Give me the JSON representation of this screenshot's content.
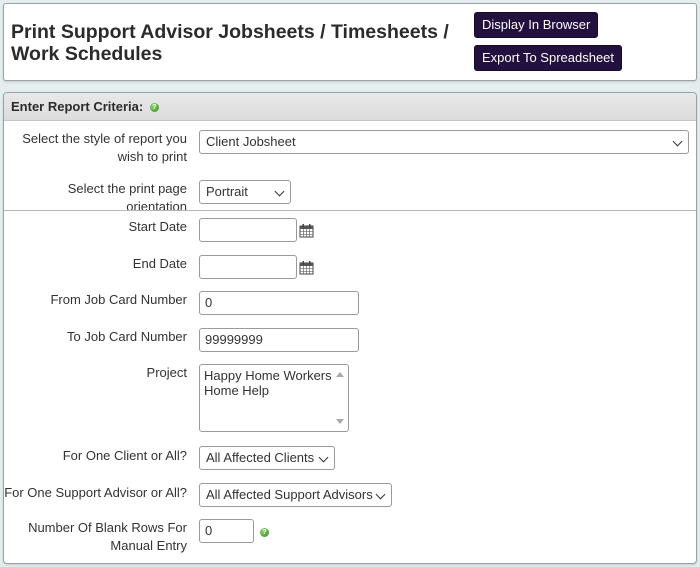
{
  "header": {
    "title": "Print Support Advisor Jobsheets / Timesheets / Work Schedules",
    "buttons": {
      "display": "Display In Browser",
      "export": "Export To Spreadsheet"
    }
  },
  "panel": {
    "title": "Enter Report Criteria:",
    "help_icon": "?",
    "fields": {
      "report_style": {
        "label": "Select the style of report you wish to print",
        "value": "Client Jobsheet"
      },
      "orientation": {
        "label": "Select the print page orientation",
        "value": "Portrait"
      },
      "start_date": {
        "label": "Start Date",
        "value": ""
      },
      "end_date": {
        "label": "End Date",
        "value": ""
      },
      "from_job": {
        "label": "From Job Card Number",
        "value": "0"
      },
      "to_job": {
        "label": "To Job Card Number",
        "value": "99999999"
      },
      "project": {
        "label": "Project",
        "options": [
          "Happy Home Workers",
          "Home Help"
        ]
      },
      "client": {
        "label": "For One Client or All?",
        "value": "All Affected Clients"
      },
      "advisor": {
        "label": "For One Support Advisor or All?",
        "value": "All Affected Support Advisors"
      },
      "blank_rows": {
        "label": "Number Of Blank Rows For Manual Entry",
        "value": "0"
      }
    }
  },
  "colors": {
    "button_bg": "#22103f",
    "background": "#e4eeee",
    "help_icon": "#3a9a24"
  }
}
